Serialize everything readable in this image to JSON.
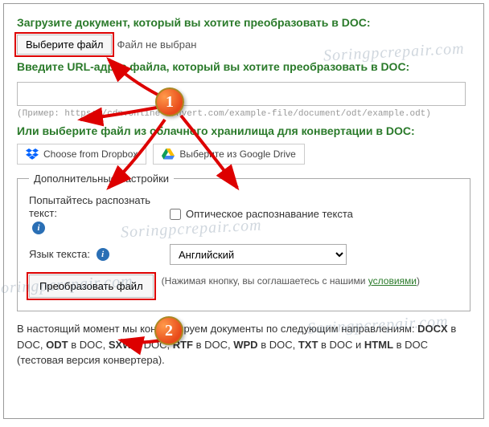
{
  "heading_upload": "Загрузите документ, который вы хотите преобразовать в DOC:",
  "choose_file_btn": "Выберите файл",
  "file_status": "Файл не выбран",
  "heading_url": "Введите URL-адрес файла, который вы хотите преобразовать в DOC:",
  "url_example": "(Пример: https://cdn.online-convert.com/example-file/document/odt/example.odt)",
  "heading_cloud": "Или выберите файл из облачного хранилища для конвертации в DOC:",
  "dropbox_btn": "Choose from Dropbox",
  "gdrive_btn": "Выберите из Google Drive",
  "fieldset_legend": "Дополнительные настройки",
  "ocr_label": "Попытайтесь распознать текст:",
  "ocr_checkbox_label": "Оптическое распознавание текста",
  "lang_label": "Язык текста:",
  "lang_value": "Английский",
  "convert_btn": "Преобразовать файл",
  "disclaimer_pre": "(Нажимая кнопку, вы соглашаетесь с нашими ",
  "disclaimer_link": "условиями",
  "disclaimer_post": ")",
  "bottom_intro": "В настоящий момент мы конвертируем документы по следующим направлениям: ",
  "bottom_formats": "DOCX в DOC, ODT в DOC, SXW в DOC, RTF в DOC, WPD в DOC, TXT в DOC и HTML в DOC (тестовая версия конвертера).",
  "watermark_text": "Soringpcrepair.com",
  "badge1": "1",
  "badge2": "2"
}
